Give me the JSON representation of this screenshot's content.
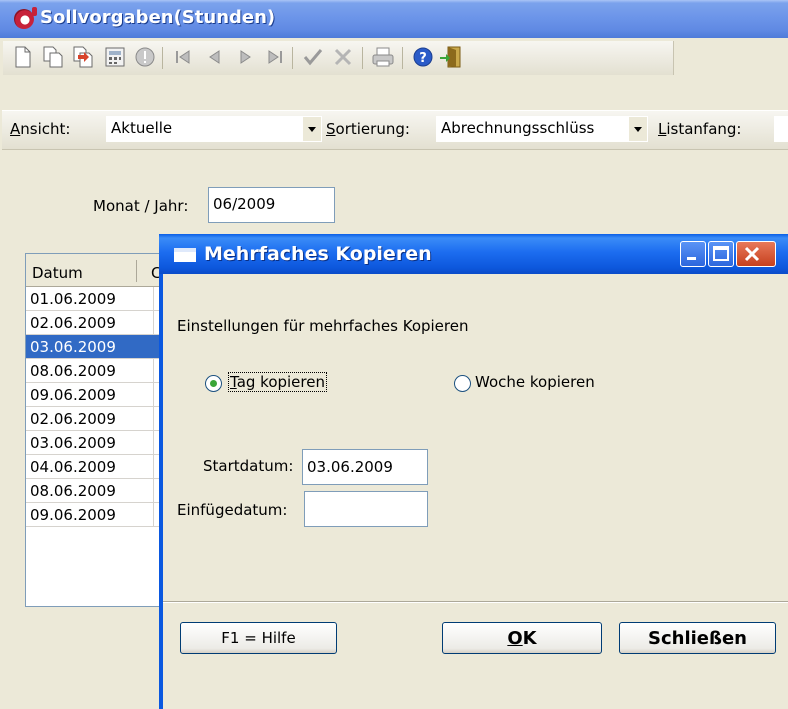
{
  "window": {
    "title": "Sollvorgaben(Stunden)"
  },
  "toolbar": {
    "buttons": [
      "new-icon",
      "copy-icon",
      "copy-multiple-icon",
      "calculator-icon",
      "info-icon",
      "first-record-icon",
      "previous-record-icon",
      "next-record-icon",
      "last-record-icon",
      "confirm-icon",
      "cancel-icon",
      "print-icon",
      "help-icon",
      "exit-icon"
    ]
  },
  "filter": {
    "view_label": "Ansicht:",
    "view_value": "Aktuelle",
    "sort_label": "Sortierung:",
    "sort_value": "Abrechnungsschlüss",
    "list_start_label": "Listanfang:"
  },
  "content": {
    "month_year_label": "Monat / Jahr:",
    "month_year_value": "06/2009"
  },
  "grid": {
    "columns": [
      "Datum",
      "C"
    ],
    "rows": [
      "01.06.2009",
      "02.06.2009",
      "03.06.2009",
      "08.06.2009",
      "09.06.2009",
      "02.06.2009",
      "03.06.2009",
      "04.06.2009",
      "08.06.2009",
      "09.06.2009"
    ],
    "selected_index": 2
  },
  "dialog": {
    "title": "Mehrfaches Kopieren",
    "heading": "Einstellungen für mehrfaches Kopieren",
    "option_day": "Tag kopieren",
    "option_week": "Woche kopieren",
    "selected_option": "day",
    "start_label": "Startdatum:",
    "start_value": "03.06.2009",
    "insert_label": "Einfügedatum:",
    "insert_value": "",
    "help_button": "F1 = Hilfe",
    "ok_button": "OK",
    "close_button": "Schließen"
  },
  "colors": {
    "xp_blue": "#0a58e0",
    "selection": "#316ac5",
    "face": "#ece9d8"
  }
}
